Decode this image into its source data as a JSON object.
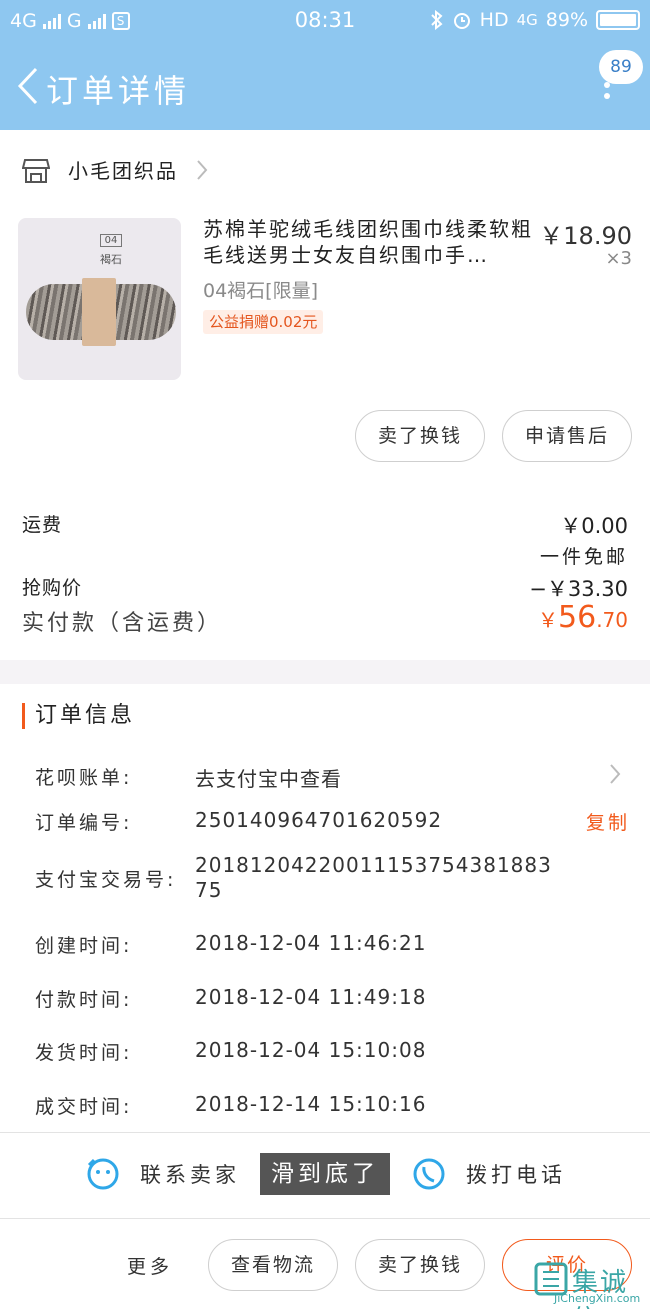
{
  "status_bar": {
    "carrier1": "4G",
    "carrier2": "G",
    "sim_box": "S",
    "time": "08:31",
    "network": "HD",
    "network2": "4G",
    "battery": "89%"
  },
  "nav": {
    "title": "订单详情",
    "message_count": "89"
  },
  "shop": {
    "name": "小毛团织品"
  },
  "product": {
    "title": "苏棉羊驼绒毛线团织围巾线柔软粗毛线送男士女友自织围巾手…",
    "price": "￥18.90",
    "quantity": "×3",
    "sku": "04褐石[限量]",
    "donation": "公益捐赠0.02元",
    "thumb_code": "04",
    "thumb_color_name": "褐石"
  },
  "item_buttons": {
    "sell": "卖了换钱",
    "after_sale": "申请售后"
  },
  "fees": {
    "shipping_label": "运费",
    "shipping_value": "￥0.00",
    "shipping_note": "一件免邮",
    "flash_label": "抢购价",
    "flash_value": "−￥33.30",
    "paid_label": "实付款（含运费）",
    "paid_symbol": "￥",
    "paid_int": "56",
    "paid_dec": ".70"
  },
  "order_info": {
    "heading": "订单信息",
    "rows": [
      {
        "key": "花呗账单:",
        "value": "去支付宝中查看"
      },
      {
        "key": "订单编号:",
        "value": "250140964701620592",
        "action": "复制"
      },
      {
        "key": "支付宝交易号:",
        "value": "20181204220011153754381883",
        "value2": "75"
      },
      {
        "key": "创建时间:",
        "value": "2018-12-04 11:46:21"
      },
      {
        "key": "付款时间:",
        "value": "2018-12-04 11:49:18"
      },
      {
        "key": "发货时间:",
        "value": "2018-12-04 15:10:08"
      },
      {
        "key": "成交时间:",
        "value": "2018-12-14 15:10:16"
      }
    ]
  },
  "contact": {
    "seller": "联系卖家",
    "call": "拨打电话",
    "toast": "滑到底了"
  },
  "actions": {
    "more": "更多",
    "logistics": "查看物流",
    "sell": "卖了换钱",
    "review": "评价"
  },
  "watermark": {
    "text": "集诚信",
    "url": "JiChengXin.com"
  }
}
